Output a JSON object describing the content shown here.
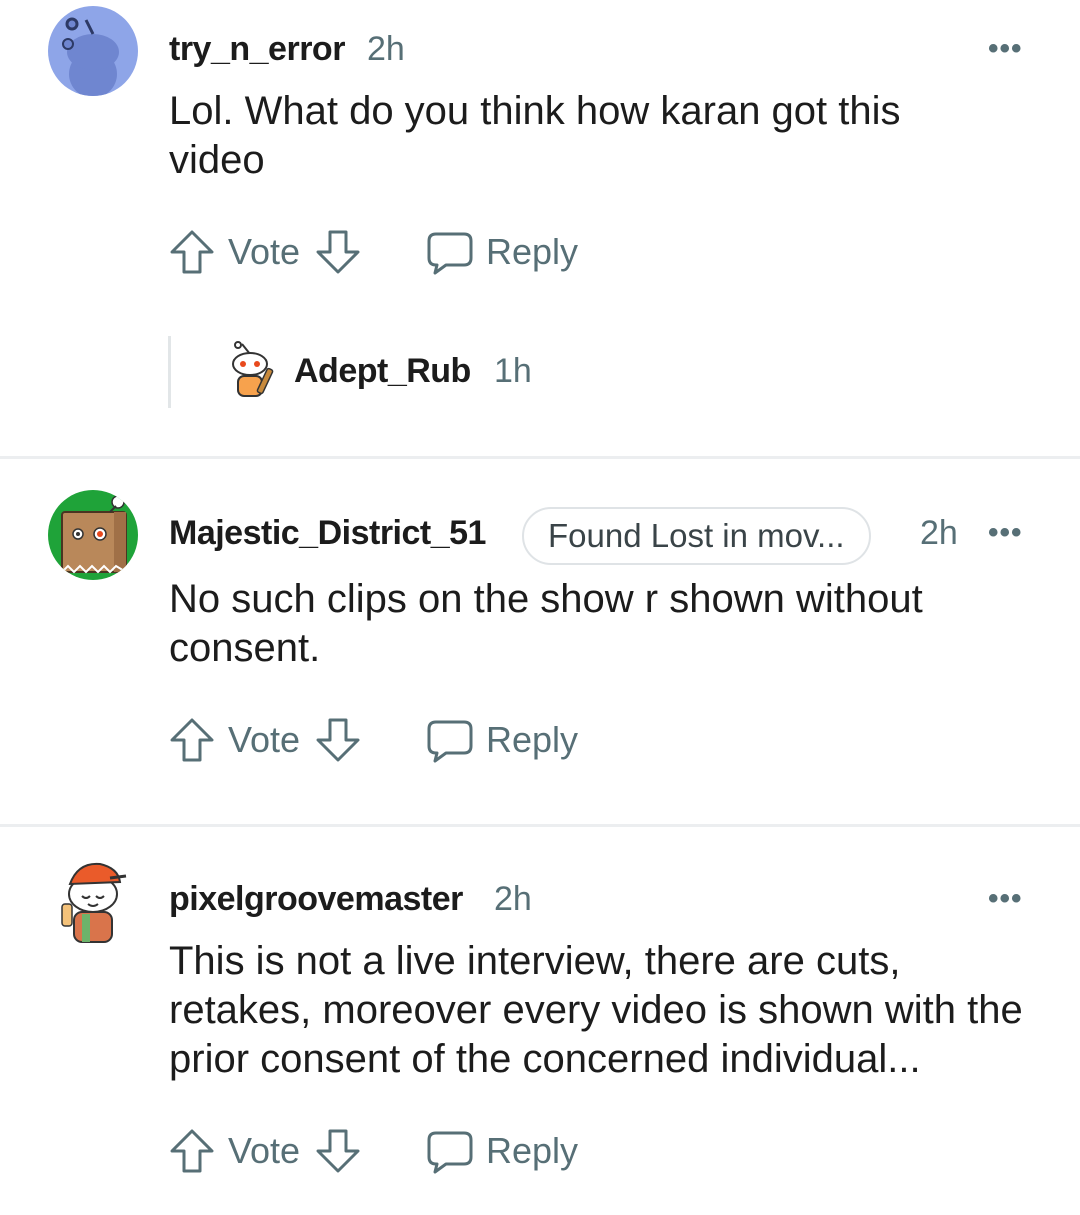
{
  "comments": [
    {
      "username": "try_n_error",
      "time": "2h",
      "body": "Lol. What do you think how karan got this video",
      "vote_label": "Vote",
      "reply_label": "Reply",
      "more_label": "•••"
    },
    {
      "username": "Majestic_District_51",
      "flair": "Found Lost in mov...",
      "time": "2h",
      "body": "No such clips on the show r shown without consent.",
      "vote_label": "Vote",
      "reply_label": "Reply",
      "more_label": "•••"
    },
    {
      "username": "pixelgroovemaster",
      "time": "2h",
      "body": "This is not a live interview, there are cuts, retakes, moreover every video is shown with the prior consent of the concerned individual...",
      "vote_label": "Vote",
      "reply_label": "Reply",
      "more_label": "•••"
    }
  ],
  "collapsed_reply": {
    "username": "Adept_Rub",
    "time": "1h"
  },
  "colors": {
    "meta_gray": "#576f76",
    "avatar_blue": "#8ea5e8",
    "avatar_green": "#1fa339",
    "divider": "#eceef0"
  },
  "icons": [
    "snoo-avatar-icon",
    "paper-bag-avatar-icon",
    "cap-avatar-icon",
    "upvote-arrow-icon",
    "downvote-arrow-icon",
    "reply-bubble-icon",
    "more-options-icon"
  ]
}
